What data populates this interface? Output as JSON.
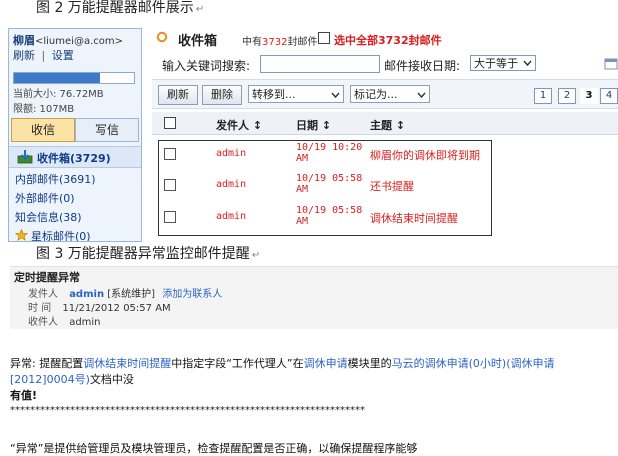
{
  "figure2": {
    "caption": "图 2 万能提醒器邮件展示",
    "sidebar": {
      "user_name": "柳眉",
      "user_email": "<liumei@a.com>",
      "link_refresh": "刷新",
      "link_separator": "|",
      "link_settings": "设置",
      "quota_fraction": 0.72,
      "size_text": "当前大小: 76.72MB",
      "limit_text": "限额: 107MB",
      "receive_button": "收信",
      "write_button": "写信",
      "inbox_label": "收件箱(3729)",
      "items": [
        "内部邮件(3691)",
        "外部邮件(0)",
        "知会信息(38)",
        "星标邮件(0)"
      ]
    },
    "mailbox": {
      "title": "收件箱",
      "count_prefix": "中有",
      "count_value": "3732",
      "count_suffix": "封邮件",
      "select_all": "选中全部3732封邮件",
      "search_label": "输入关键词搜索:",
      "search_value": "",
      "date_label": "邮件接收日期:",
      "date_option": "大于等于",
      "refresh_button": "刷新",
      "delete_button": "删除",
      "move_select": "转移到...",
      "mark_select": "标记为...",
      "pages": [
        "1",
        "2",
        "3",
        "4"
      ],
      "current_page": "3",
      "columns": [
        "发件人",
        "日期",
        "主题"
      ],
      "rows": [
        {
          "sender": "admin",
          "date_line1": "10/19 10:20",
          "date_line2": "AM",
          "subject": "柳眉你的调休即将到期"
        },
        {
          "sender": "admin",
          "date_line1": "10/19 05:58",
          "date_line2": "AM",
          "subject": "还书提醒"
        },
        {
          "sender": "admin",
          "date_line1": "10/19 05:58",
          "date_line2": "AM",
          "subject": "调休结束时间提醒"
        }
      ]
    }
  },
  "figure3": {
    "caption": "图 3 万能提醒器异常监控邮件提醒",
    "subject": "定时提醒异常",
    "sender_label": "发件人",
    "sender_name": "admin",
    "sender_tag": "[系统维护]",
    "add_contact": "添加为联系人",
    "time_label": "时 间",
    "time_value": "11/21/2012 05:57 AM",
    "recipient_label": "收件人",
    "recipient_value": "admin",
    "body": {
      "part1": "异常: 提醒配置",
      "link1": "调休结束时间提醒",
      "part2": "中指定字段“工作代理人”在",
      "link2": "调休申请",
      "part3": "模块里的",
      "link3": "马云的调休申请(0小时)(调休申请[2012]0004号)",
      "part4": "文档中没",
      "line2": "有值!",
      "stars": "***********************************************************************",
      "closing": "“异常”是提供给管理员及模块管理员，检查提醒配置是否正确，以确保提醒程序能够"
    }
  }
}
